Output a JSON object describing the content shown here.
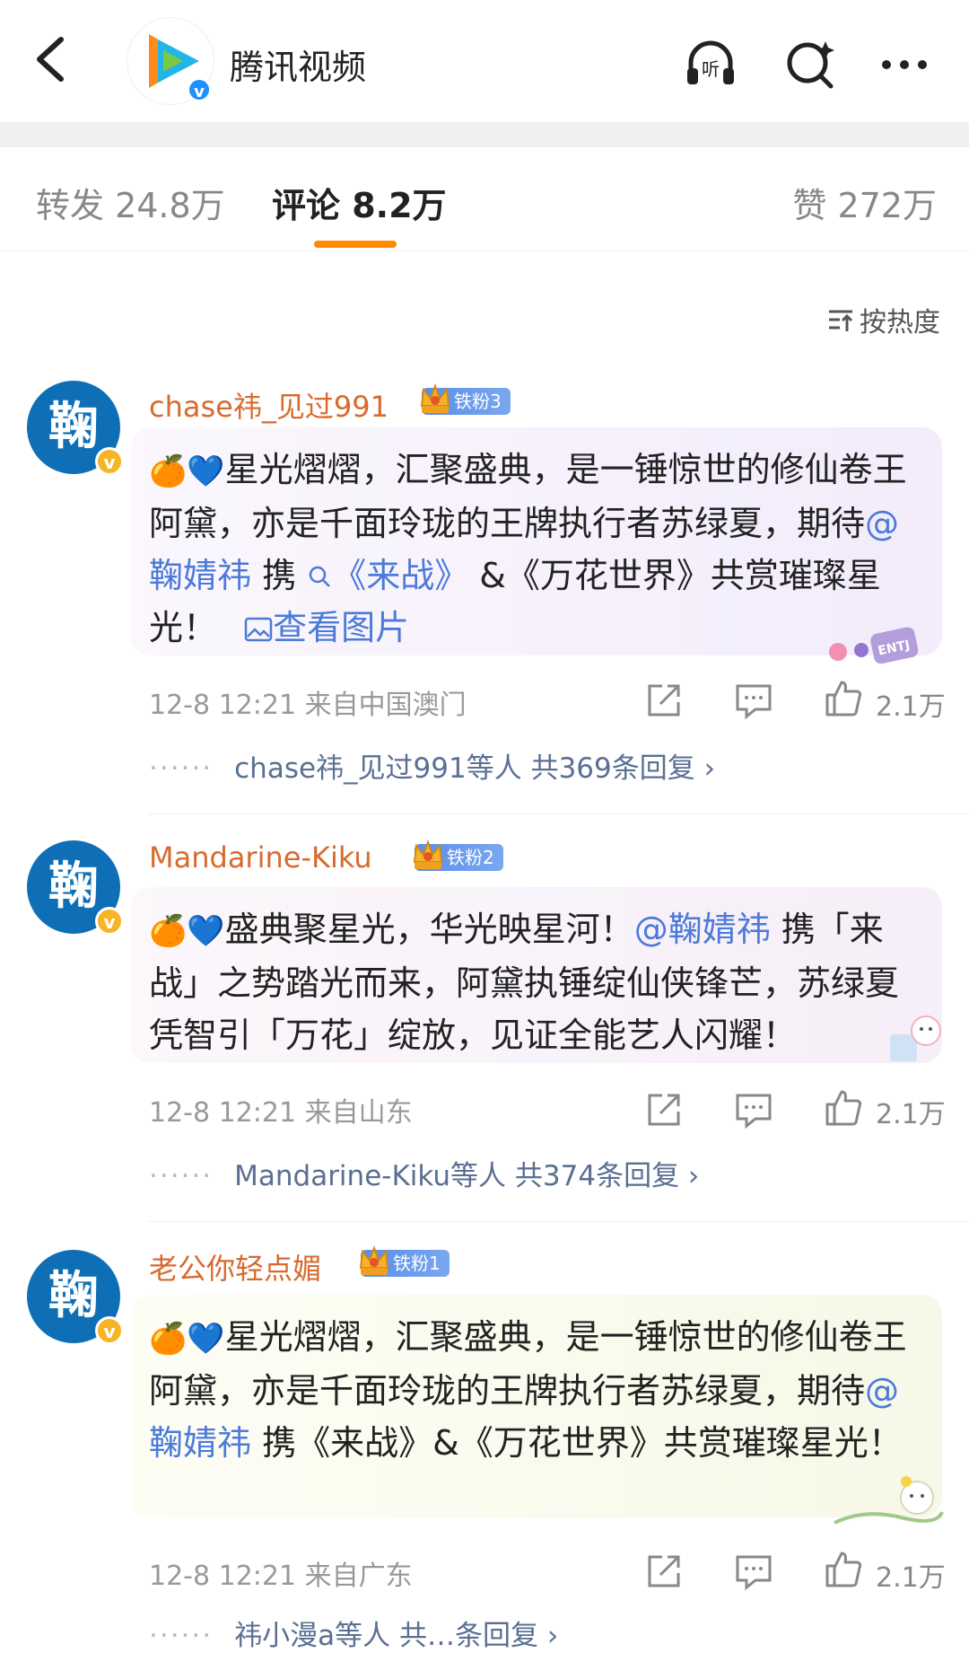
{
  "header": {
    "app_title": "腾讯视频"
  },
  "tabs": {
    "repost": "转发 24.8万",
    "comment": "评论 8.2万",
    "like": "赞 272万"
  },
  "sort_label": "按热度",
  "comments": [
    {
      "avatar_char": "鞠",
      "username": "chase祎_见过991",
      "fan_badge": "铁粉3",
      "emoji": "🍊💙",
      "text_a": "星光熠熠，汇聚盛典，是一锤惊世的修仙卷王阿黛，亦是千面玲珑的王牌执行者苏绿夏，期待",
      "mention": "@鞠婧祎",
      "text_b": " 携",
      "topic": "《来战》",
      "text_c": " &《万花世界》共赏璀璨星光！",
      "view_image": "查看图片",
      "sticker": "ENTJ",
      "time": "12-8 12:21",
      "location": "来自中国澳门",
      "likes": "2.1万",
      "replies_who": "chase祎_见过991等人",
      "replies_count": "共369条回复 ›"
    },
    {
      "avatar_char": "鞠",
      "username": "Mandarine-Kiku",
      "fan_badge": "铁粉2",
      "emoji": "🍊💙",
      "text_a": "盛典聚星光，华光映星河！",
      "mention": "@鞠婧祎",
      "text_b": " 携「来战」之势踏光而来，阿黛执锤绽仙侠锋芒，苏绿夏凭智引「万花」绽放，见证全能艺人闪耀！",
      "time": "12-8 12:21",
      "location": "来自山东",
      "likes": "2.1万",
      "replies_who": "Mandarine-Kiku等人",
      "replies_count": "共374条回复 ›"
    },
    {
      "avatar_char": "鞠",
      "username": "老公你轻点媚",
      "fan_badge": "铁粉1",
      "emoji": "🍊💙",
      "text_a": "星光熠熠，汇聚盛典，是一锤惊世的修仙卷王阿黛，亦是千面玲珑的王牌执行者苏绿夏，期待",
      "mention": "@鞠婧祎",
      "text_b": " 携《来战》&《万花世界》共赏璀璨星光！",
      "time": "12-8 12:21",
      "location": "来自广东",
      "likes": "2.1万",
      "replies_who": "祎小漫a等人",
      "replies_count": "共…条回复 ›"
    }
  ],
  "colors": {
    "accent": "#ff8a00",
    "username": "#d86a2e",
    "link": "#4c7ad9",
    "avatar_bg": "#0f6fb6"
  }
}
